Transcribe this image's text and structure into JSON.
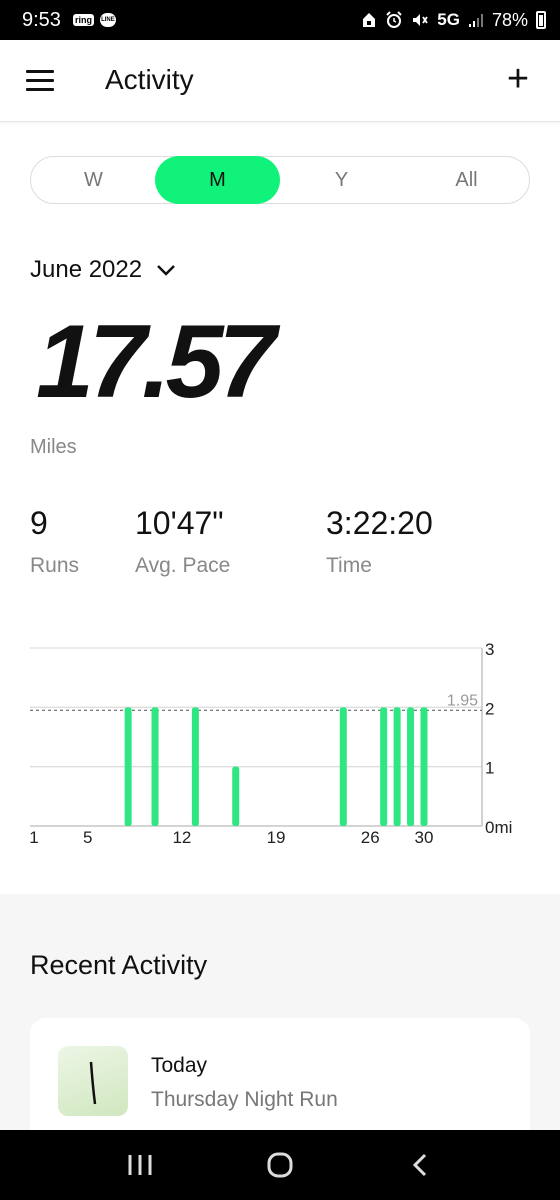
{
  "status_bar": {
    "time": "9:53",
    "apps": [
      "ring",
      "LINE"
    ],
    "network": "5G",
    "battery": "78%"
  },
  "header": {
    "title": "Activity",
    "add_label": "+"
  },
  "period_tabs": [
    {
      "label": "W",
      "active": false
    },
    {
      "label": "M",
      "active": true
    },
    {
      "label": "Y",
      "active": false
    },
    {
      "label": "All",
      "active": false
    }
  ],
  "month_selector": {
    "label": "June 2022"
  },
  "summary": {
    "distance": "17.57",
    "distance_unit": "Miles",
    "runs_value": "9",
    "runs_label": "Runs",
    "pace_value": "10'47\"",
    "pace_label": "Avg. Pace",
    "time_value": "3:22:20",
    "time_label": "Time"
  },
  "chart_data": {
    "type": "bar",
    "x": [
      8,
      10,
      13,
      16,
      24,
      27,
      28,
      29,
      30
    ],
    "values": [
      2.0,
      2.0,
      2.0,
      1.0,
      2.0,
      2.0,
      2.0,
      2.0,
      2.0
    ],
    "xlim": [
      1,
      31
    ],
    "ylim": [
      0,
      3
    ],
    "x_ticks": [
      "1",
      "5",
      "12",
      "19",
      "26",
      "30"
    ],
    "y_ticks": [
      "3",
      "2",
      "1",
      "0mi"
    ],
    "average_line": {
      "value": 1.95,
      "label": "1.95"
    },
    "grid": true,
    "bar_color": "#2ee682"
  },
  "recent": {
    "title": "Recent Activity",
    "items": [
      {
        "day": "Today",
        "name": "Thursday Night Run"
      }
    ]
  },
  "colors": {
    "accent": "#11f27a",
    "muted_text": "#888888"
  }
}
